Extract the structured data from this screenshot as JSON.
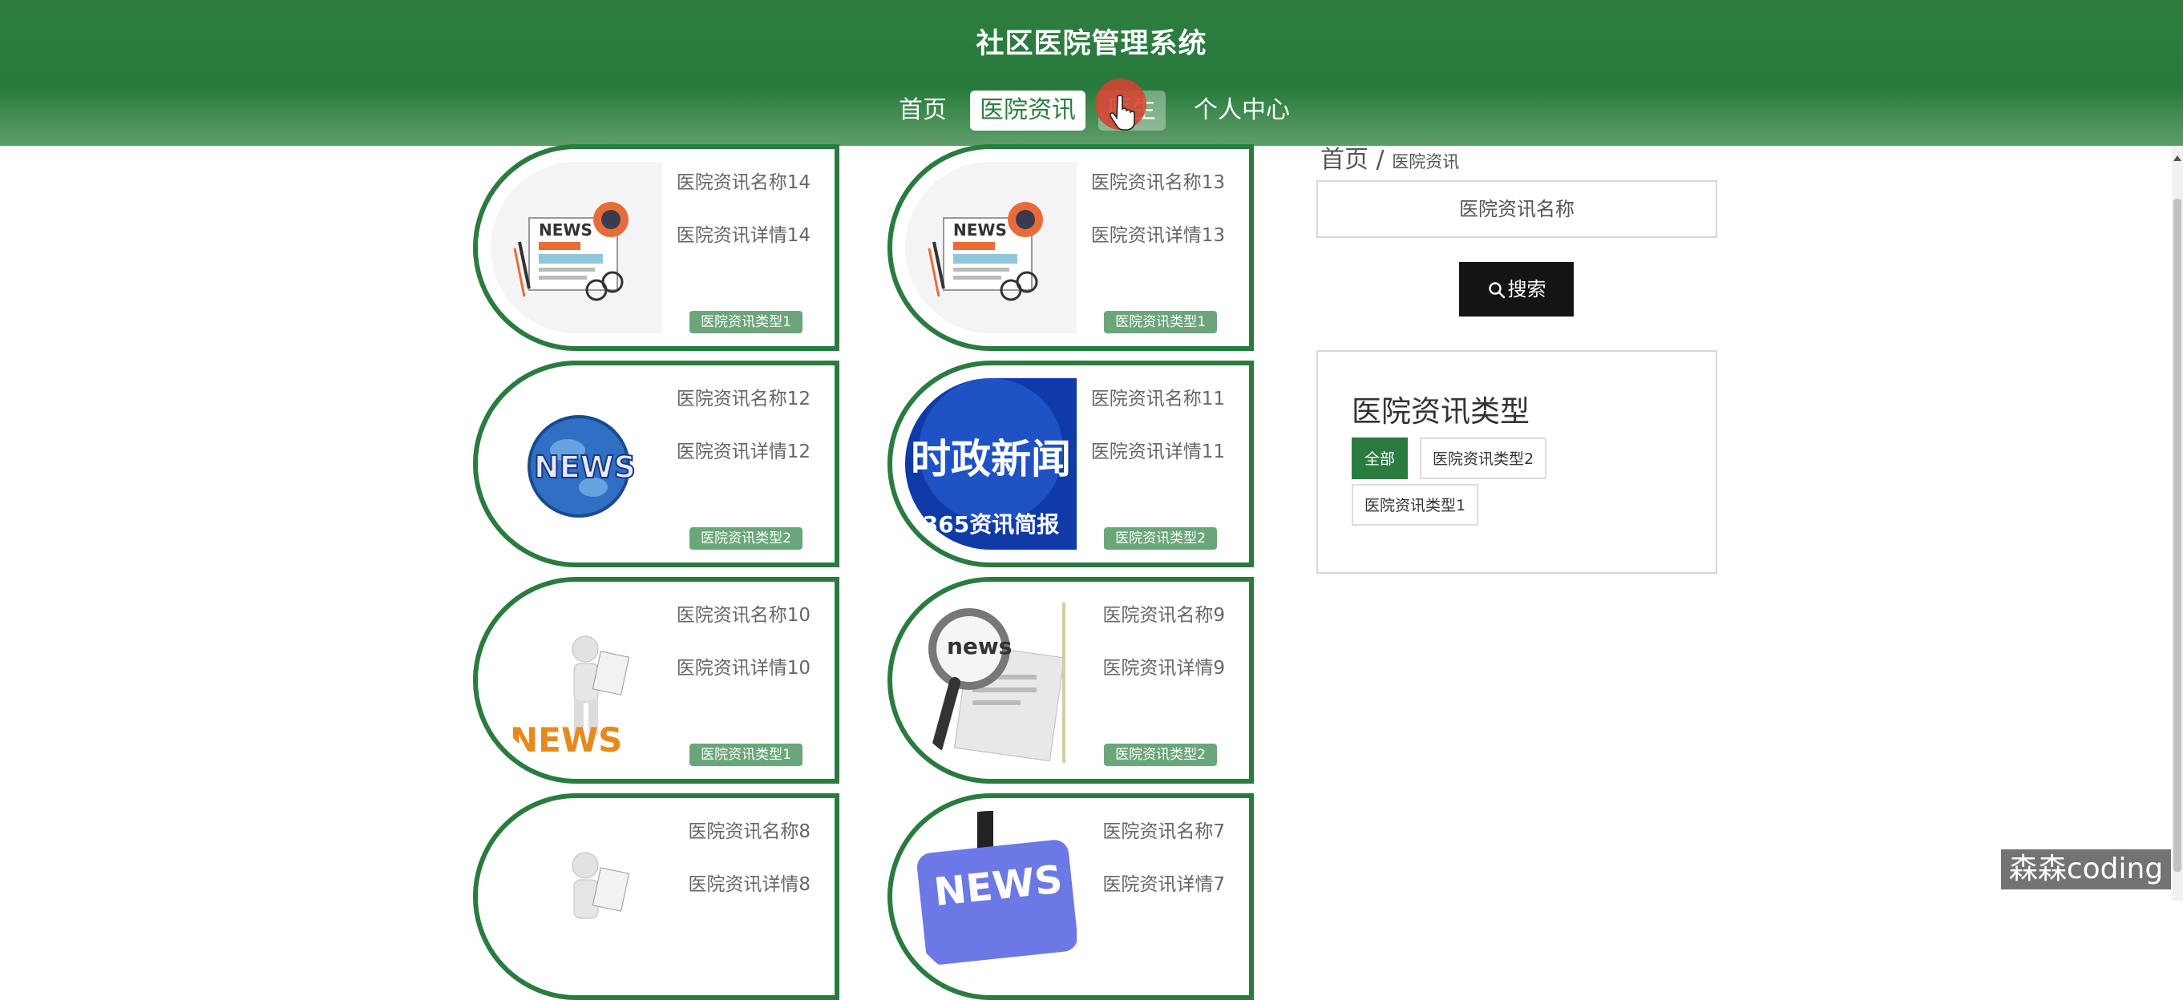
{
  "header": {
    "title": "社区医院管理系统",
    "nav": [
      {
        "label": "首页"
      },
      {
        "label": "医院资讯"
      },
      {
        "label": "医生"
      },
      {
        "label": "个人中心"
      }
    ]
  },
  "cards": [
    {
      "title": "医院资讯名称14",
      "detail": "医院资讯详情14",
      "type": "医院资讯类型1",
      "thumb": "news-paper-illustration"
    },
    {
      "title": "医院资讯名称13",
      "detail": "医院资讯详情13",
      "type": "医院资讯类型1",
      "thumb": "news-paper-illustration"
    },
    {
      "title": "医院资讯名称12",
      "detail": "医院资讯详情12",
      "type": "医院资讯类型2",
      "thumb": "news-globe"
    },
    {
      "title": "医院资讯名称11",
      "detail": "医院资讯详情11",
      "type": "医院资讯类型2",
      "thumb": "political-news-banner",
      "thumb_text": "时政新闻",
      "thumb_subtext": "365资讯简报"
    },
    {
      "title": "医院资讯名称10",
      "detail": "医院资讯详情10",
      "type": "医院资讯类型1",
      "thumb": "person-reading-news"
    },
    {
      "title": "医院资讯名称9",
      "detail": "医院资讯详情9",
      "type": "医院资讯类型2",
      "thumb": "news-magnifier"
    },
    {
      "title": "医院资讯名称8",
      "detail": "医院资讯详情8",
      "type": "",
      "thumb": "person-reading-news"
    },
    {
      "title": "医院资讯名称7",
      "detail": "医院资讯详情7",
      "type": "",
      "thumb": "news-blue-sign"
    }
  ],
  "thumb_words": {
    "news_caps": "NEWS",
    "news_lower": "news"
  },
  "breadcrumb": {
    "home": "首页",
    "separator": "/",
    "current": "医院资讯"
  },
  "search": {
    "placeholder": "医院资讯名称",
    "button_label": "搜索"
  },
  "types": {
    "title": "医院资讯类型",
    "tags": [
      {
        "label": "全部",
        "active": true
      },
      {
        "label": "医院资讯类型2",
        "active": false
      },
      {
        "label": "医院资讯类型1",
        "active": false
      }
    ]
  },
  "watermark": "森森coding",
  "colors": {
    "primary": "#2a7b40",
    "badge": "#6aa679",
    "search_button": "#141414",
    "cursor": "#d64230"
  }
}
